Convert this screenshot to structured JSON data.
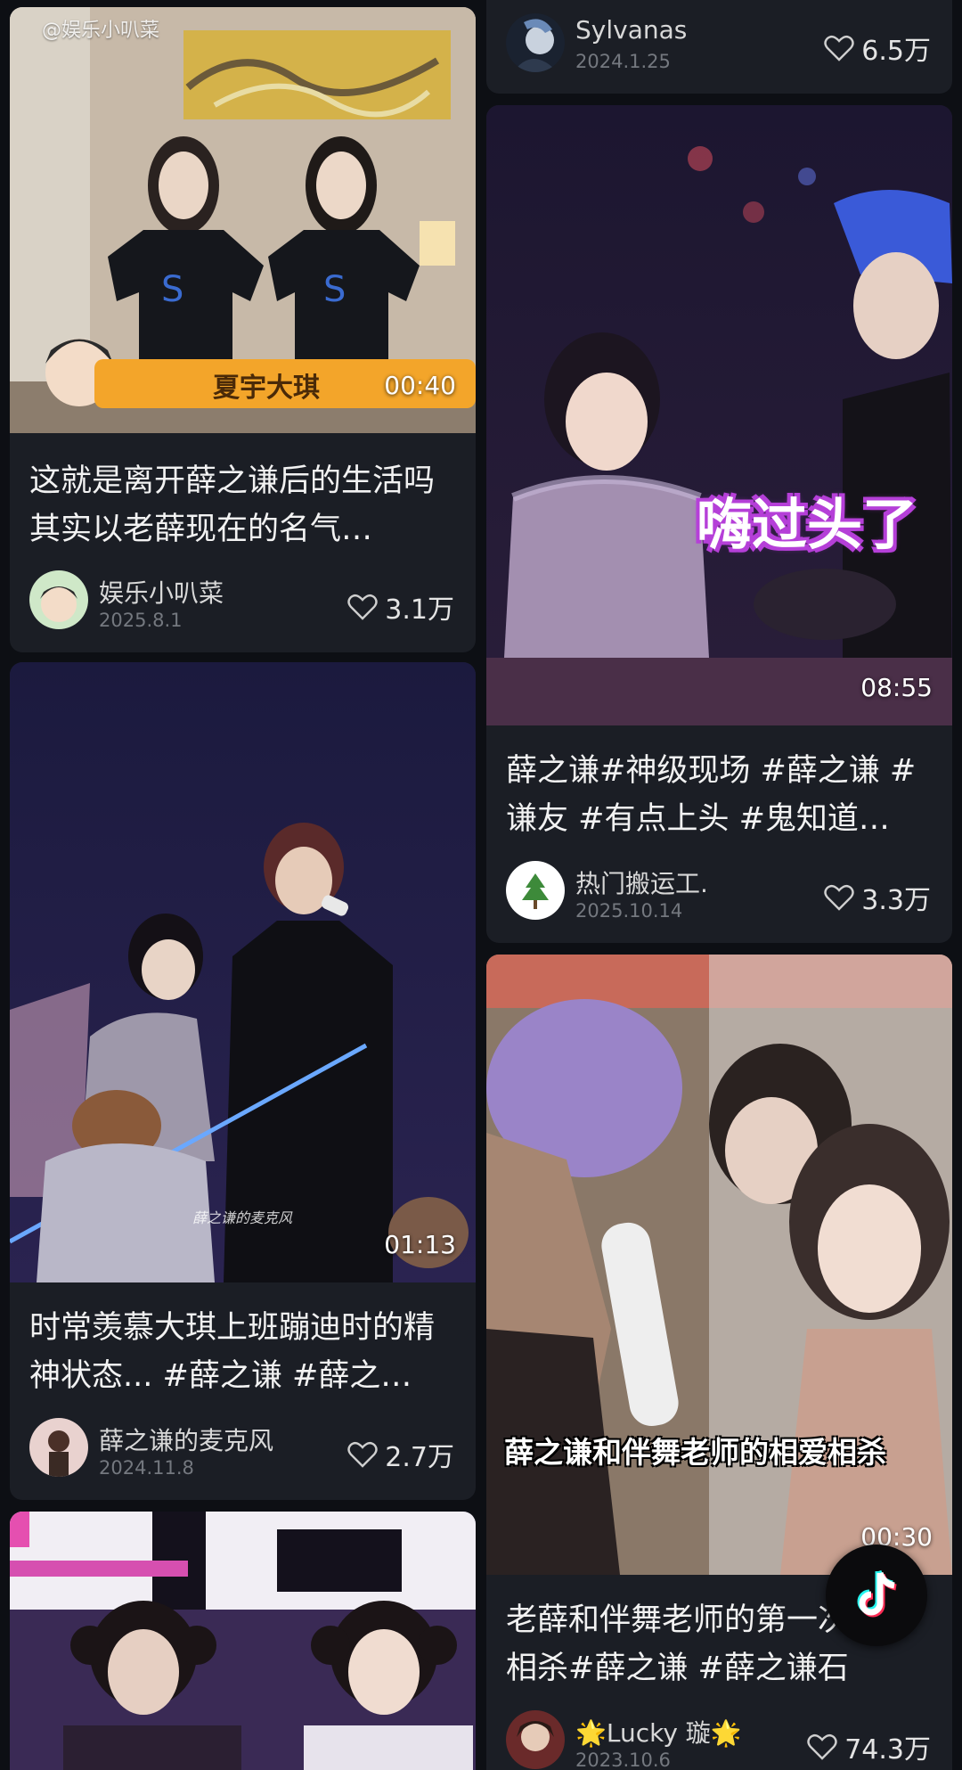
{
  "cards": [
    {
      "watermark": "@娱乐小叭菜",
      "caption_banner": "夏宇大琪",
      "duration": "00:40",
      "title": "这就是离开薛之谦后的生活吗 其实以老薛现在的名气…",
      "author": "娱乐小叭菜",
      "date": "2025.8.1",
      "likes": "3.1万"
    },
    {
      "duration": "01:13",
      "photo_caption": "薛之谦的麦克风",
      "title": "时常羡慕大琪上班蹦迪时的精神状态... #薛之谦 #薛之…",
      "author": "薛之谦的麦克风",
      "date": "2024.11.8",
      "likes": "2.7万"
    },
    {
      "author": "Sylvanas",
      "date": "2024.1.25",
      "likes": "6.5万"
    },
    {
      "overlay_text": "嗨过头了",
      "duration": "08:55",
      "title": "薛之谦#神级现场 #薛之谦 #谦友 #有点上头 #鬼知道…",
      "author": "热门搬运工.",
      "date": "2025.10.14",
      "likes": "3.3万"
    },
    {
      "subtitle": "薛之谦和伴舞老师的相爱相杀",
      "duration": "00:30",
      "title": "老薛和伴舞老师的第一次相爱相杀#薛之谦 #薛之谦石",
      "author": "🌟Lucky 璇🌟",
      "date": "2023.10.6",
      "likes": "74.3万"
    }
  ],
  "icons": {
    "like": "heart-outline-icon",
    "app": "tiktok-logo-icon"
  },
  "colors": {
    "background": "#0d0f14",
    "card": "#1b1e25",
    "banner_orange": "#f3a52a"
  }
}
